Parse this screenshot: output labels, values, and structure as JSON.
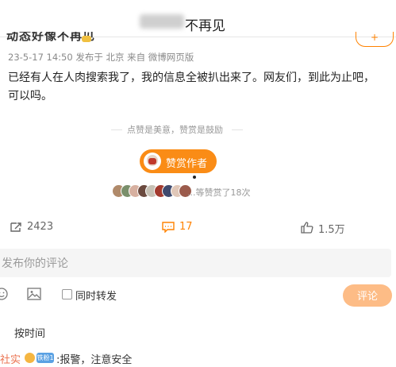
{
  "header": {
    "title_suffix": "不再见",
    "follow_label": "+"
  },
  "post": {
    "author_partial": "动态好像不再见",
    "time": "23-5-17 14:50",
    "location": "发布于 北京",
    "source": "来自 微博网页版",
    "text": "已经有人在人肉搜索我了，我的信息全被扒出来了。网友们，到此为止吧，可以吗。"
  },
  "reward": {
    "motto": "点赞是美意，赞赏是鼓励",
    "button_label": "赞赏作者",
    "likers_text": "...等赞赏了18次",
    "liker_colors": [
      "#b08a6a",
      "#7a8f6b",
      "#d7b0a0",
      "#6b4a3f",
      "#c7c1b5",
      "#a33a2e",
      "#3f4a6e",
      "#e0c7b8",
      "#9b5b4c"
    ]
  },
  "actions": {
    "repost_count": "2423",
    "comment_count": "17",
    "like_count": "1.5万"
  },
  "composer": {
    "placeholder": "发布你的评论",
    "repost_label": "同时转发",
    "submit_label": "评论"
  },
  "comments": {
    "sort_label": "按时间",
    "items": [
      {
        "user": "社实",
        "badge": "铁粉1",
        "text": ":报警，注意安全"
      }
    ]
  },
  "colors": {
    "accent": "#ff8200",
    "reward_button": "#fa8c16",
    "submit_disabled": "#fdbc86"
  }
}
